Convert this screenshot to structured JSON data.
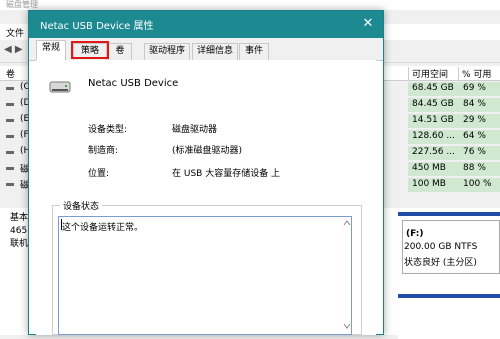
{
  "background": {
    "window_title": "磁盘管理",
    "menu_file": "文件",
    "header_vol": "卷",
    "header_free": "可用空间",
    "header_pct": "% 可用",
    "volumes": [
      {
        "label": "(C",
        "free": "68.45 GB",
        "pct": "69 %"
      },
      {
        "label": "(D",
        "free": "84.45 GB",
        "pct": "84 %"
      },
      {
        "label": "(E",
        "free": "14.51 GB",
        "pct": "29 %"
      },
      {
        "label": "(F",
        "free": "128.60 ...",
        "pct": "64 %"
      },
      {
        "label": "(H",
        "free": "227.56 ...",
        "pct": "76 %"
      },
      {
        "label": "磁",
        "free": "450 MB",
        "pct": "88 %"
      },
      {
        "label": "磁",
        "free": "100 MB",
        "pct": "100 %"
      }
    ],
    "disk_info": [
      "基本",
      "465.",
      "联机"
    ],
    "partition": {
      "name": "(F:)",
      "size": "200.00 GB NTFS",
      "status": "状态良好 (主分区)"
    }
  },
  "dialog": {
    "title": "Netac USB Device 属性",
    "close": "✕",
    "tabs": [
      "常规",
      "策略",
      "卷",
      "驱动程序",
      "详细信息",
      "事件"
    ],
    "device_name": "Netac USB Device",
    "props": [
      {
        "label": "设备类型:",
        "value": "磁盘驱动器"
      },
      {
        "label": "制造商:",
        "value": "(标准磁盘驱动器)"
      },
      {
        "label": "位置:",
        "value": "在 USB 大容量存储设备 上"
      }
    ],
    "status_group": "设备状态",
    "status_text": "这个设备运转正常。"
  }
}
